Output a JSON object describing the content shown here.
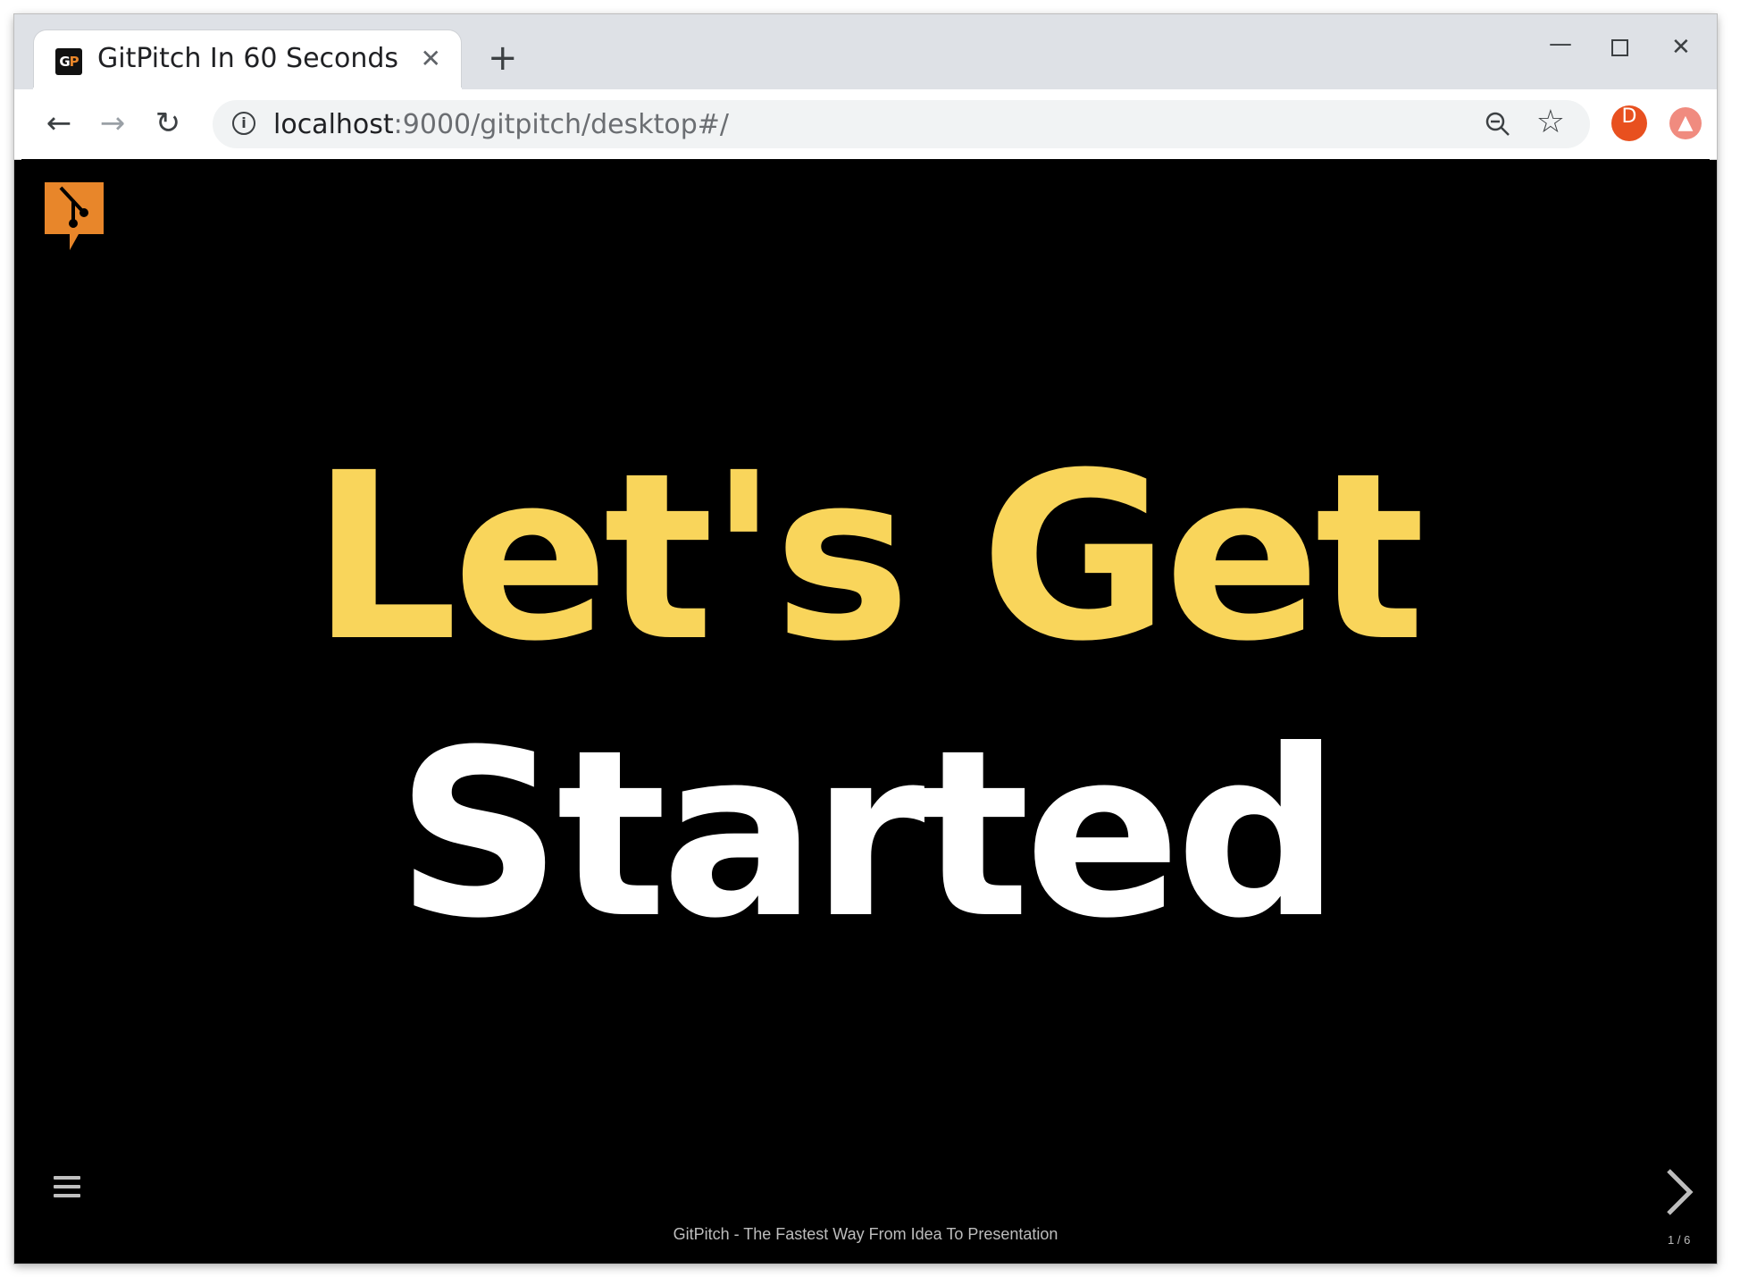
{
  "browser": {
    "tab_title": "GitPitch In 60 Seconds",
    "favicon_text_g": "G",
    "favicon_text_p": "P",
    "tab_close": "✕",
    "new_tab": "+",
    "win_min": "—",
    "win_close": "✕",
    "url_host": "localhost",
    "url_rest": ":9000/gitpitch/desktop#/",
    "avatar_letter": "D"
  },
  "slide": {
    "line1": "Let's Get",
    "line2": "Started",
    "footer": "GitPitch - The Fastest Way From Idea To Presentation",
    "counter": "1 / 6"
  },
  "colors": {
    "accent_yellow": "#f9d55b",
    "logo_orange": "#e8862a",
    "background": "#000000"
  },
  "icons": [
    "back-arrow-icon",
    "forward-arrow-icon",
    "reload-icon",
    "info-icon",
    "zoom-out-icon",
    "star-icon",
    "update-icon",
    "menu-icon",
    "chevron-right-icon",
    "gitpitch-logo"
  ]
}
